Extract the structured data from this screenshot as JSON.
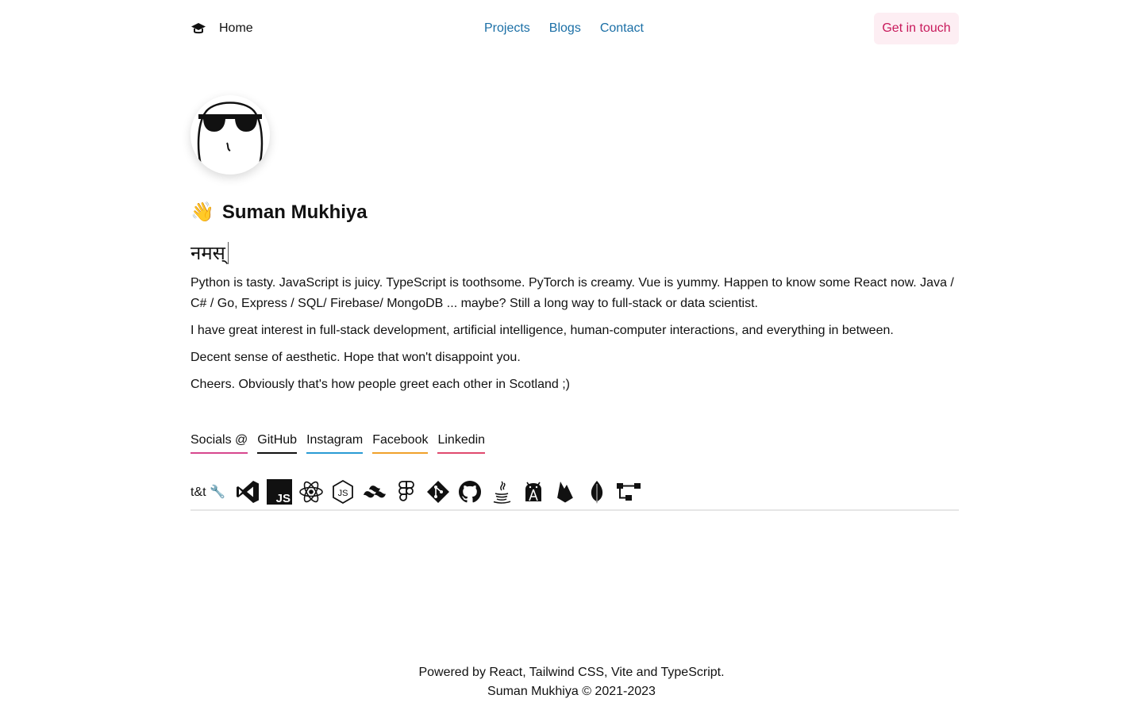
{
  "header": {
    "home_label": "Home",
    "home_icon": "graduation-cap-icon",
    "links": [
      "Projects",
      "Blogs",
      "Contact"
    ],
    "cta_label": "Get in touch"
  },
  "profile": {
    "wave_emoji": "👋",
    "name": "Suman Mukhiya",
    "greeting": "नमस्",
    "bio": [
      "Python is tasty. JavaScript is juicy. TypeScript is toothsome. PyTorch is creamy. Vue is yummy. Happen to know some React now. Java / C# / Go, Express / SQL/ Firebase/ MongoDB ... maybe? Still a long way to full-stack or data scientist.",
      "I have great interest in full-stack development, artificial intelligence, human-computer interactions, and everything in between.",
      "Decent sense of aesthetic. Hope that won't disappoint you.",
      "Cheers. Obviously that's how people greet each other in Scotland ;)"
    ]
  },
  "socials": {
    "label": "Socials @",
    "items": [
      "GitHub",
      "Instagram",
      "Facebook",
      "Linkedin"
    ]
  },
  "tools": {
    "label": "t&t 🔧",
    "icons": [
      "vscode-icon",
      "javascript-icon",
      "react-icon",
      "nodejs-icon",
      "tailwind-icon",
      "figma-icon",
      "git-icon",
      "github-icon",
      "java-icon",
      "android-studio-icon",
      "firebase-icon",
      "mongodb-icon",
      "sourcetree-icon"
    ]
  },
  "footer": {
    "line1": "Powered by React, Tailwind CSS, Vite and TypeScript.",
    "line2": "Suman Mukhiya © 2021-2023"
  },
  "colors": {
    "link": "#1b6fa6",
    "cta_text": "#c8195b",
    "cta_bg": "#fdeef3"
  }
}
